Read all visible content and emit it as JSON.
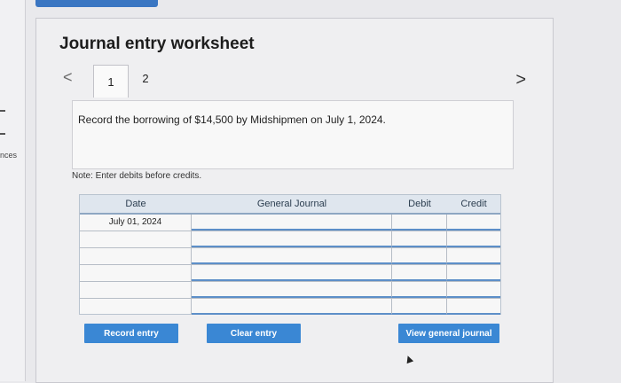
{
  "left_fragment": "nces",
  "worksheet": {
    "title": "Journal entry worksheet",
    "tabs": [
      {
        "label": "1"
      },
      {
        "label": "2"
      }
    ],
    "prev_glyph": "<",
    "next_glyph": ">",
    "instruction": "Record the borrowing of $14,500 by Midshipmen on July 1, 2024.",
    "note": "Note: Enter debits before credits."
  },
  "journal": {
    "headers": {
      "date": "Date",
      "account": "General Journal",
      "debit": "Debit",
      "credit": "Credit"
    },
    "rows": [
      {
        "date": "July 01, 2024",
        "account": "",
        "debit": "",
        "credit": ""
      },
      {
        "date": "",
        "account": "",
        "debit": "",
        "credit": ""
      },
      {
        "date": "",
        "account": "",
        "debit": "",
        "credit": ""
      },
      {
        "date": "",
        "account": "",
        "debit": "",
        "credit": ""
      },
      {
        "date": "",
        "account": "",
        "debit": "",
        "credit": ""
      },
      {
        "date": "",
        "account": "",
        "debit": "",
        "credit": ""
      }
    ]
  },
  "buttons": {
    "record": "Record entry",
    "clear": "Clear entry",
    "view": "View general journal"
  },
  "colors": {
    "accent": "#3a87d4",
    "header_bg": "#dfe6ee"
  }
}
